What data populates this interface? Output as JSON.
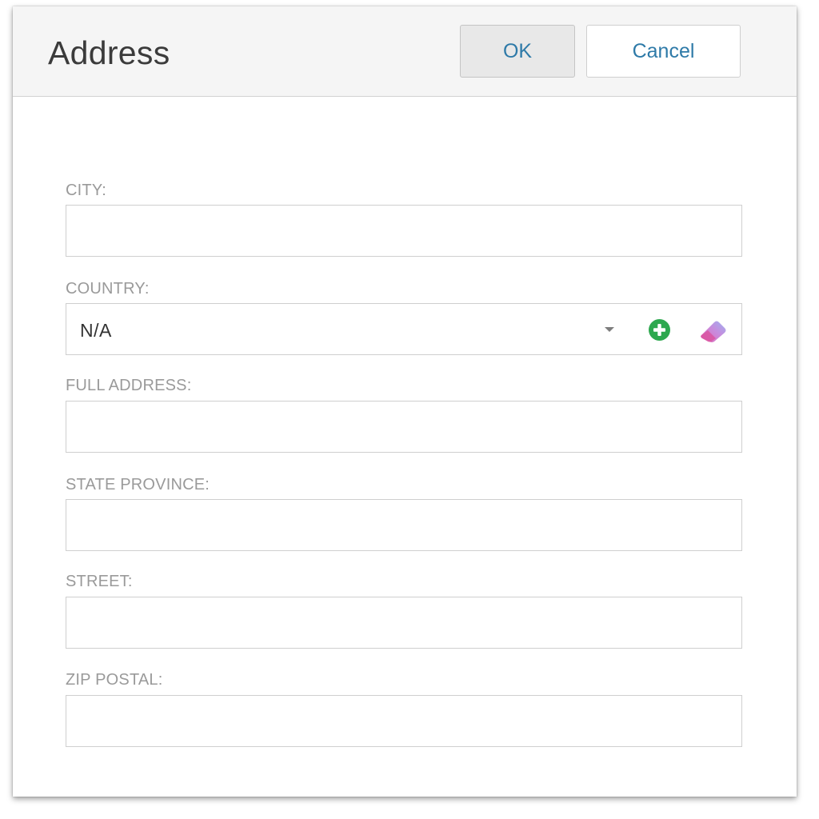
{
  "dialog": {
    "title": "Address",
    "ok_label": "OK",
    "cancel_label": "Cancel"
  },
  "fields": {
    "city": {
      "label": "CITY:",
      "value": ""
    },
    "country": {
      "label": "COUNTRY:",
      "value": "N/A"
    },
    "full_address": {
      "label": "FULL ADDRESS:",
      "value": ""
    },
    "state_province": {
      "label": "STATE PROVINCE:",
      "value": ""
    },
    "street": {
      "label": "STREET:",
      "value": ""
    },
    "zip_postal": {
      "label": "ZIP POSTAL:",
      "value": ""
    }
  },
  "icons": {
    "dropdown": "chevron-down-icon",
    "add": "add-circle-icon",
    "clear": "eraser-icon"
  },
  "colors": {
    "accent_text": "#2e7aa8",
    "add_icon": "#2ea84f",
    "header_bg": "#f5f5f5",
    "label_text": "#9a9a9a"
  }
}
